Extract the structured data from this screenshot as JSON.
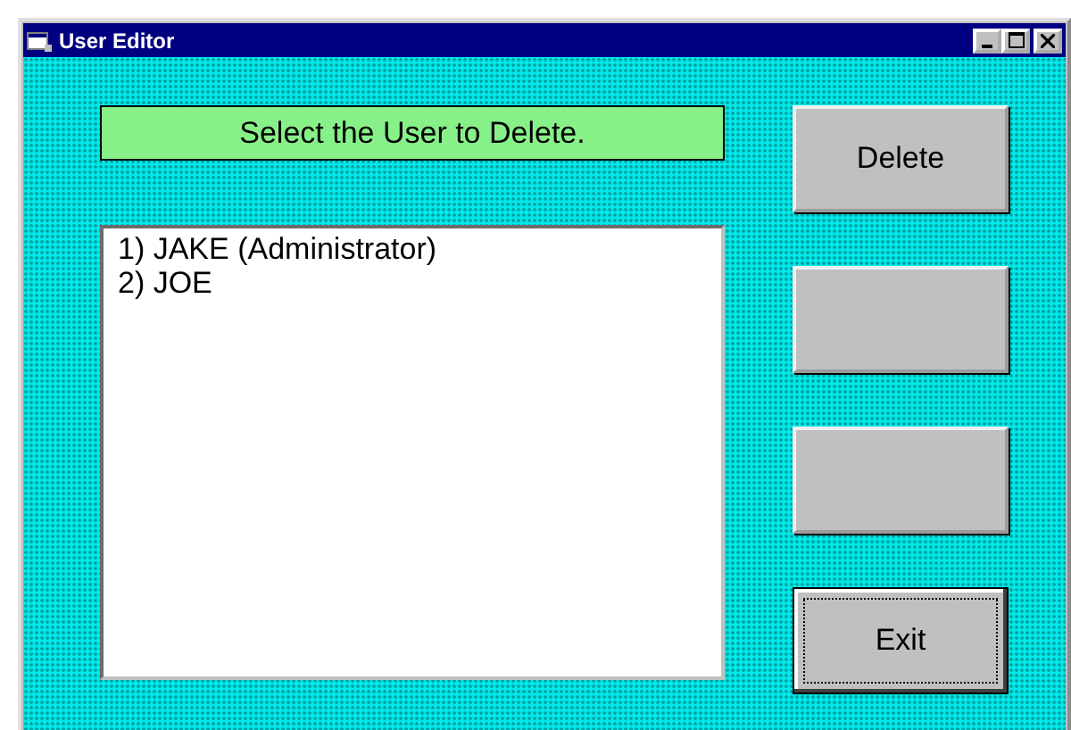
{
  "window": {
    "title": "User Editor"
  },
  "prompt": "Select the User to Delete.",
  "users": [
    "1) JAKE (Administrator)",
    "2) JOE"
  ],
  "buttons": [
    {
      "label": "Delete",
      "focused": false
    },
    {
      "focused": false
    },
    {
      "focused": false
    },
    {
      "label": "Exit",
      "focused": true
    }
  ]
}
